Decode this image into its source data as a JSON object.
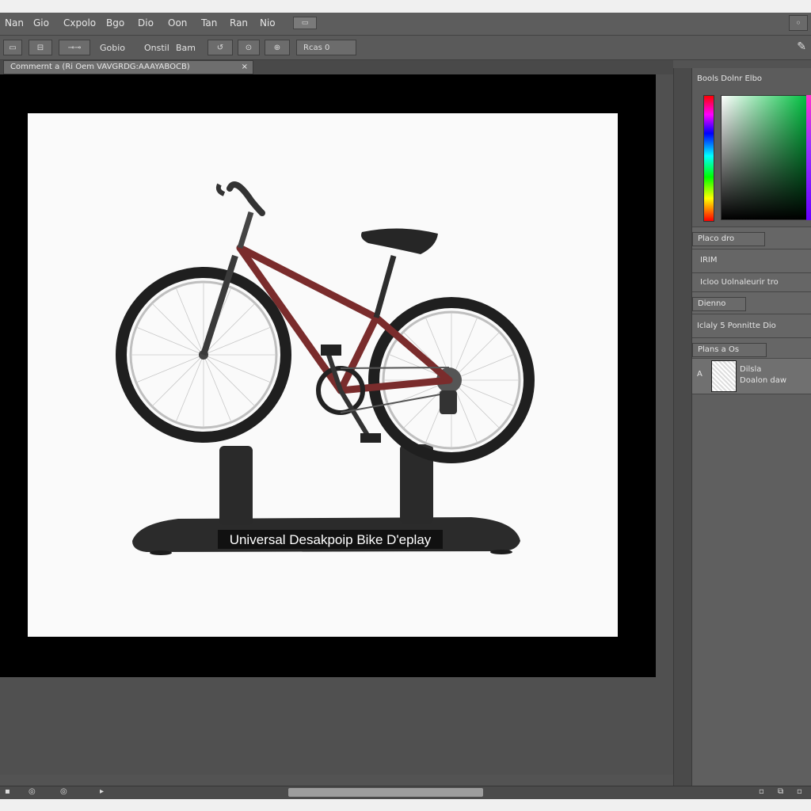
{
  "menu": {
    "items": [
      "Nan",
      "Gio",
      "Cxpolo",
      "Bgo",
      "Dio",
      "Oon",
      "Tan",
      "Ran",
      "Nio"
    ],
    "badge": "▭",
    "window_button": "◦"
  },
  "options": {
    "buttons": [
      "▭",
      "⊟",
      "⊸⊸",
      "Gobio",
      "Onstil",
      "Bam",
      "↺",
      "⊙",
      "⊕"
    ],
    "size_field": "Rcas 0"
  },
  "document": {
    "tab_title": "Commernt a (Ri Oem VAVGRDG:AAAYABOCB)",
    "close": "×",
    "product_label": "Universal Desakpoip Bike D'eplay"
  },
  "panels": {
    "color_title": "Bools Dolnr Elbo",
    "styles_tab": "Placo dro",
    "tab_row_label": "IRIM",
    "row_text": "Icloo  Uolnaleurir tro",
    "adjust_tab": "Dienno",
    "adjust_row": "Iclaly  5  Ponnitte  Dio",
    "layers_tab": "Plans a Os",
    "layer_name": "Dilsla",
    "layer_sub": "Doalon daw",
    "layer_lock": "A"
  },
  "colors": {
    "frame_red": "#7a2c2c",
    "stand": "#2b2b2b"
  }
}
